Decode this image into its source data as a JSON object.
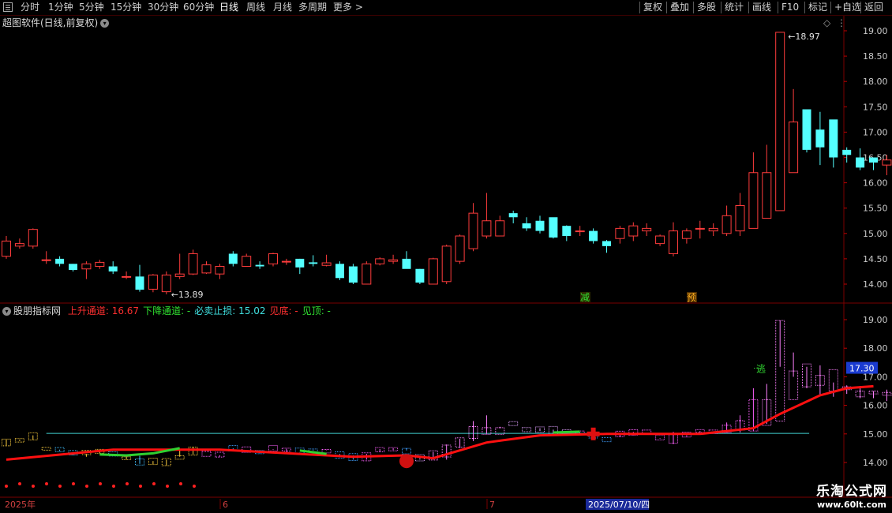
{
  "toolbar": {
    "periods": [
      "分时",
      "1分钟",
      "5分钟",
      "15分钟",
      "30分钟",
      "60分钟",
      "日线",
      "周线",
      "月线",
      "多周期"
    ],
    "more": "更多 >",
    "active_period": "日线",
    "actions": [
      "复权",
      "叠加",
      "多股",
      "统计",
      "画线",
      "F10",
      "标记",
      "+自选",
      "返回"
    ]
  },
  "main_panel": {
    "title": "超图软件(日线,前复权)",
    "price_axis": [
      "19.00",
      "18.50",
      "18.00",
      "17.50",
      "17.00",
      "16.50",
      "16.00",
      "15.50",
      "15.00",
      "14.50",
      "14.00"
    ],
    "high_label": "18.97",
    "low_label": "13.89",
    "markers": [
      "减",
      "预"
    ]
  },
  "indicator_panel": {
    "name": "股朋指标网",
    "params": [
      {
        "label": "上升通道",
        "value": "16.67",
        "color": "#ff3030"
      },
      {
        "label": "下降通道",
        "value": "-",
        "color": "#30e030"
      },
      {
        "label": "必卖止损",
        "value": "15.02",
        "color": "#40e0e0"
      },
      {
        "label": "见底",
        "value": "-",
        "color": "#ff3030"
      },
      {
        "label": "见顶",
        "value": "-",
        "color": "#30e030"
      }
    ],
    "price_axis": [
      "19.00",
      "18.00",
      "17.00",
      "16.00",
      "15.00",
      "14.00"
    ],
    "current_price": "17.30",
    "signal_label": "逃"
  },
  "time_axis": {
    "labels": [
      "2025年",
      "6",
      "7"
    ],
    "cursor_date": "2025/07/10/四"
  },
  "watermark": {
    "title": "乐淘公式网",
    "url": "www.60lt.com"
  },
  "colors": {
    "up": "#ff3c3c",
    "down": "#54ffff",
    "grid": "#7a0000",
    "axis_text": "#c8c8c8"
  },
  "chart_data": {
    "type": "candlestick",
    "open": [
      14.55,
      14.75,
      14.75,
      14.48,
      14.5,
      14.4,
      14.3,
      14.35,
      14.35,
      14.15,
      14.15,
      13.9,
      13.85,
      14.15,
      14.2,
      14.22,
      14.2,
      14.6,
      14.35,
      14.38,
      14.4,
      14.45,
      14.5,
      14.43,
      14.37,
      14.4,
      14.35,
      14.0,
      14.4,
      14.45,
      14.5,
      14.3,
      14.0,
      14.05,
      14.45,
      14.7,
      14.95,
      14.95,
      15.4,
      15.2,
      15.25,
      15.32,
      15.15,
      15.05,
      15.05,
      14.85,
      14.9,
      14.95,
      15.05,
      14.8,
      14.6,
      14.9,
      15.1,
      15.05,
      15.0,
      15.05,
      15.1,
      15.3,
      15.45,
      16.2,
      17.45,
      17.05,
      17.25,
      16.65,
      16.5,
      16.5,
      16.35,
      16.2
    ],
    "close": [
      14.85,
      14.8,
      15.08,
      14.48,
      14.4,
      14.28,
      14.4,
      14.43,
      14.25,
      14.15,
      13.89,
      14.18,
      14.18,
      14.2,
      14.6,
      14.38,
      14.35,
      14.4,
      14.55,
      14.35,
      14.6,
      14.45,
      14.33,
      14.4,
      14.42,
      14.12,
      14.03,
      14.4,
      14.5,
      14.48,
      14.3,
      14.03,
      14.5,
      14.75,
      14.95,
      15.4,
      15.25,
      15.25,
      15.32,
      15.1,
      15.05,
      14.92,
      14.95,
      15.05,
      14.85,
      14.75,
      15.1,
      15.15,
      15.1,
      14.95,
      15.05,
      15.05,
      15.1,
      15.1,
      15.35,
      15.55,
      16.2,
      16.2,
      18.97,
      17.2,
      16.65,
      16.7,
      16.5,
      16.55,
      16.3,
      16.4,
      16.45,
      16.0
    ],
    "high": [
      14.95,
      14.9,
      15.1,
      14.65,
      14.55,
      14.4,
      14.45,
      14.48,
      14.45,
      14.25,
      14.38,
      14.2,
      14.25,
      14.6,
      14.68,
      14.45,
      14.4,
      14.65,
      14.6,
      14.45,
      14.62,
      14.5,
      14.5,
      14.57,
      14.58,
      14.45,
      14.4,
      14.45,
      14.53,
      14.58,
      14.65,
      14.3,
      14.52,
      14.78,
      14.98,
      15.6,
      15.8,
      15.35,
      15.45,
      15.32,
      15.35,
      15.3,
      15.16,
      15.15,
      15.1,
      14.87,
      15.15,
      15.22,
      15.2,
      14.98,
      15.22,
      15.1,
      15.25,
      15.2,
      15.55,
      15.8,
      16.6,
      16.75,
      18.97,
      17.85,
      17.35,
      17.4,
      16.8,
      16.7,
      16.68,
      16.5,
      16.55,
      16.2
    ],
    "low": [
      14.5,
      14.7,
      14.7,
      14.4,
      14.35,
      14.25,
      14.1,
      14.3,
      14.2,
      14.1,
      13.85,
      13.84,
      13.8,
      14.1,
      14.18,
      14.2,
      14.1,
      14.35,
      14.35,
      14.3,
      14.35,
      14.38,
      14.2,
      14.35,
      14.35,
      14.08,
      14.0,
      14.0,
      14.37,
      14.4,
      14.32,
      14.0,
      14.0,
      14.0,
      14.4,
      14.65,
      14.9,
      15.15,
      15.2,
      15.05,
      15.0,
      14.9,
      14.85,
      14.95,
      14.8,
      14.62,
      14.8,
      14.85,
      14.95,
      14.75,
      14.55,
      14.8,
      14.9,
      14.95,
      14.95,
      14.95,
      15.1,
      15.35,
      17.35,
      17.0,
      16.6,
      16.35,
      16.3,
      16.4,
      16.25,
      16.25,
      16.15,
      16.15
    ],
    "ylim": [
      13.6,
      19.3
    ],
    "indicator": {
      "up_channel": [
        [
          0,
          14.1
        ],
        [
          8,
          14.45
        ],
        [
          16,
          14.45
        ],
        [
          26,
          14.2
        ],
        [
          30,
          14.25
        ],
        [
          32,
          14.15
        ],
        [
          36,
          14.7
        ],
        [
          40,
          14.95
        ],
        [
          45,
          15.0
        ],
        [
          52,
          15.0
        ],
        [
          56,
          15.2
        ],
        [
          58,
          15.7
        ],
        [
          61,
          16.35
        ],
        [
          63,
          16.6
        ],
        [
          65,
          16.67
        ]
      ],
      "stop_loss": {
        "from_index": 3,
        "to_index": 59,
        "value": 15.02
      },
      "ylim": [
        13.6,
        19.3
      ]
    }
  }
}
